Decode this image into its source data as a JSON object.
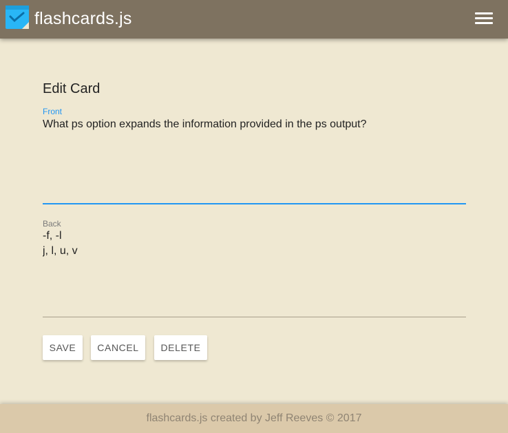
{
  "app": {
    "title": "flashcards.js",
    "logo_icon": "flashcard-check-icon",
    "menu_icon": "hamburger-menu-icon",
    "bar_color": "#7e7260",
    "logo_color": "#29b6f6"
  },
  "form": {
    "heading": "Edit Card",
    "front_label": "Front",
    "front_value": "What ps option expands the information provided in the ps output?",
    "back_label": "Back",
    "back_value": "-f, -l\nj, l, u, v",
    "accent_color": "#2196f3"
  },
  "buttons": {
    "save": "SAVE",
    "cancel": "CANCEL",
    "delete": "DELETE"
  },
  "footer": {
    "text": "flashcards.js created by Jeff Reeves © 2017"
  }
}
